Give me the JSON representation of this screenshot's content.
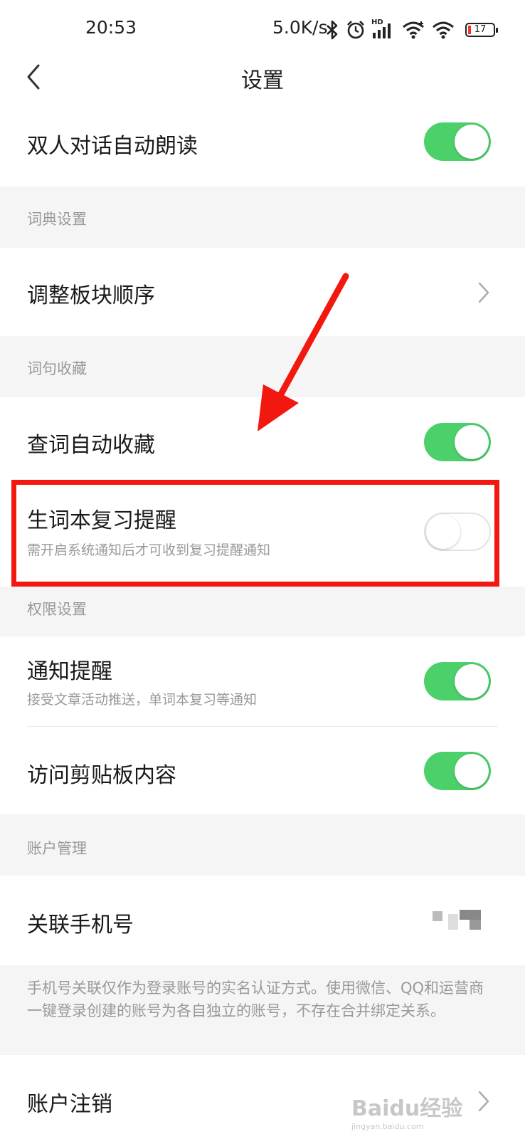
{
  "status_bar": {
    "time": "20:53",
    "speed": "5.0K/s",
    "hd_label": "HD",
    "battery_level": "17",
    "icons": [
      "bluetooth-icon",
      "alarm-icon",
      "signal-icon",
      "wifi-icon",
      "wifi-icon",
      "battery-icon"
    ]
  },
  "header": {
    "title": "设置",
    "back_icon": "chevron-left-icon"
  },
  "rows": {
    "auto_read": {
      "title": "双人对话自动朗读",
      "enabled": true
    },
    "dict_section": "词典设置",
    "reorder": {
      "title": "调整板块顺序"
    },
    "favorites_section": "词句收藏",
    "auto_collect": {
      "title": "查词自动收藏",
      "enabled": true
    },
    "review_reminder": {
      "title": "生词本复习提醒",
      "subtitle": "需开启系统通知后才可收到复习提醒通知",
      "enabled": false
    },
    "permission_section": "权限设置",
    "notifications": {
      "title": "通知提醒",
      "subtitle": "接受文章活动推送，单词本复习等通知",
      "enabled": true
    },
    "clipboard": {
      "title": "访问剪贴板内容",
      "enabled": true
    },
    "account_section": "账户管理",
    "phone": {
      "title": "关联手机号"
    },
    "phone_note": "手机号关联仅作为登录账号的实名认证方式。使用微信、QQ和运营商一键登录创建的账号为各自独立的账号，不存在合并绑定关系。",
    "deactivate": {
      "title": "账户注销"
    }
  },
  "overlay": {
    "arrow_color": "#f2170f",
    "box_color": "#f2170f"
  },
  "watermark": {
    "text": "Baidu经验",
    "url": "jingyan.baidu.com"
  },
  "colors": {
    "toggle_on": "#4cd06a",
    "section_bg": "#f5f5f5"
  }
}
